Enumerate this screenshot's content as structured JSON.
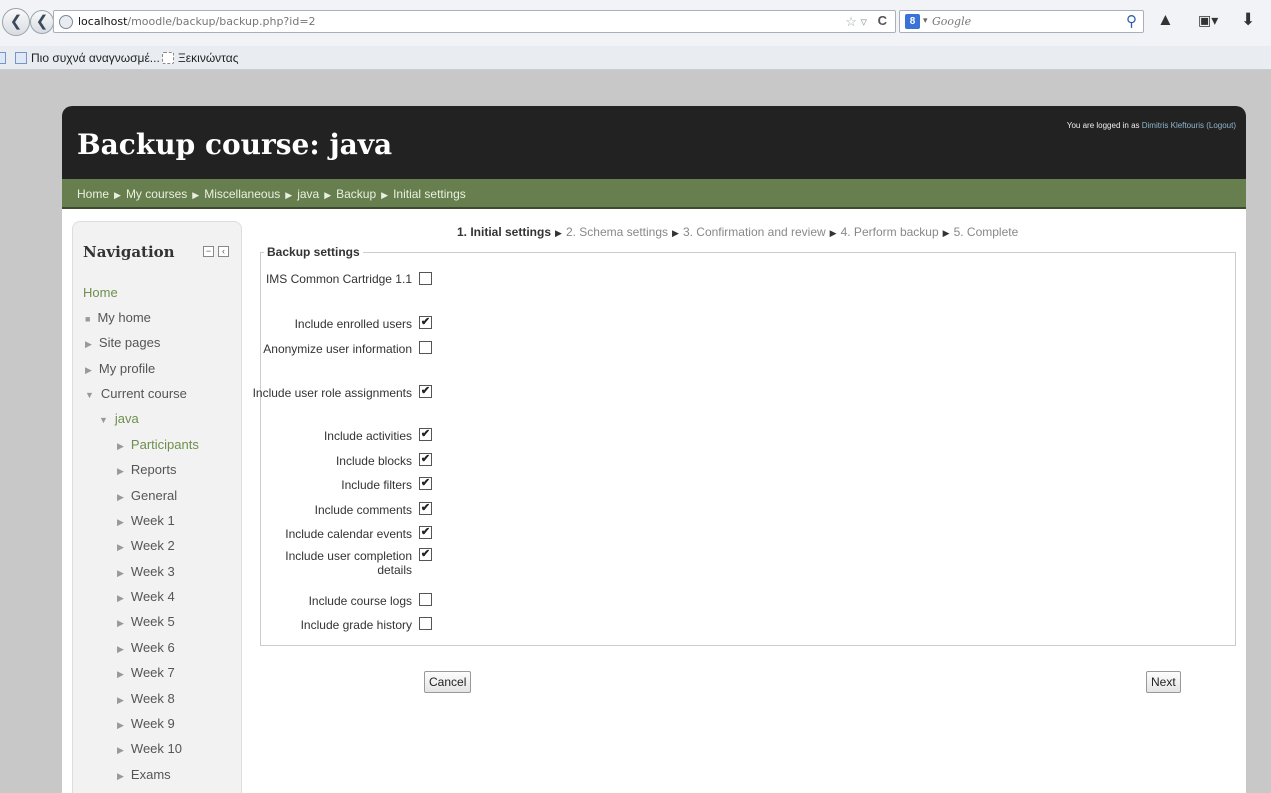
{
  "browser": {
    "url_host": "localhost",
    "url_path": "/moodle/backup/backup.php?id=2",
    "search_engine_label": "8",
    "search_placeholder": "Google",
    "bookmarks": [
      "Πιο συχνά αναγνωσμέ...",
      "Ξεκινώντας"
    ]
  },
  "header": {
    "title": "Backup course: java",
    "logged_in_prefix": "You are logged in as ",
    "user_name": "Dimitris Kleftouris",
    "logout_label": "(Logout)"
  },
  "breadcrumb": [
    "Home",
    "My courses",
    "Miscellaneous",
    "java",
    "Backup",
    "Initial settings"
  ],
  "navigation": {
    "title": "Navigation",
    "home": "Home",
    "items": [
      "My home",
      "Site pages",
      "My profile",
      "Current course",
      "java",
      "Participants",
      "Reports",
      "General",
      "Week 1",
      "Week 2",
      "Week 3",
      "Week 4",
      "Week 5",
      "Week 6",
      "Week 7",
      "Week 8",
      "Week 9",
      "Week 10",
      "Exams"
    ]
  },
  "steps": {
    "current": "1. Initial settings",
    "others": [
      "2. Schema settings",
      "3. Confirmation and review",
      "4. Perform backup",
      "5. Complete"
    ]
  },
  "form": {
    "legend": "Backup settings",
    "fields": [
      {
        "label": "IMS Common Cartridge 1.1",
        "checked": false
      },
      {
        "label": "Include enrolled users",
        "checked": true
      },
      {
        "label": "Anonymize user information",
        "checked": false
      },
      {
        "label": "Include user role assignments",
        "checked": true
      },
      {
        "label": "Include activities",
        "checked": true
      },
      {
        "label": "Include blocks",
        "checked": true
      },
      {
        "label": "Include filters",
        "checked": true
      },
      {
        "label": "Include comments",
        "checked": true
      },
      {
        "label": "Include calendar events",
        "checked": true
      },
      {
        "label": "Include user completion details",
        "checked": true
      },
      {
        "label": "Include course logs",
        "checked": false
      },
      {
        "label": "Include grade history",
        "checked": false
      }
    ],
    "cancel_label": "Cancel",
    "next_label": "Next"
  }
}
